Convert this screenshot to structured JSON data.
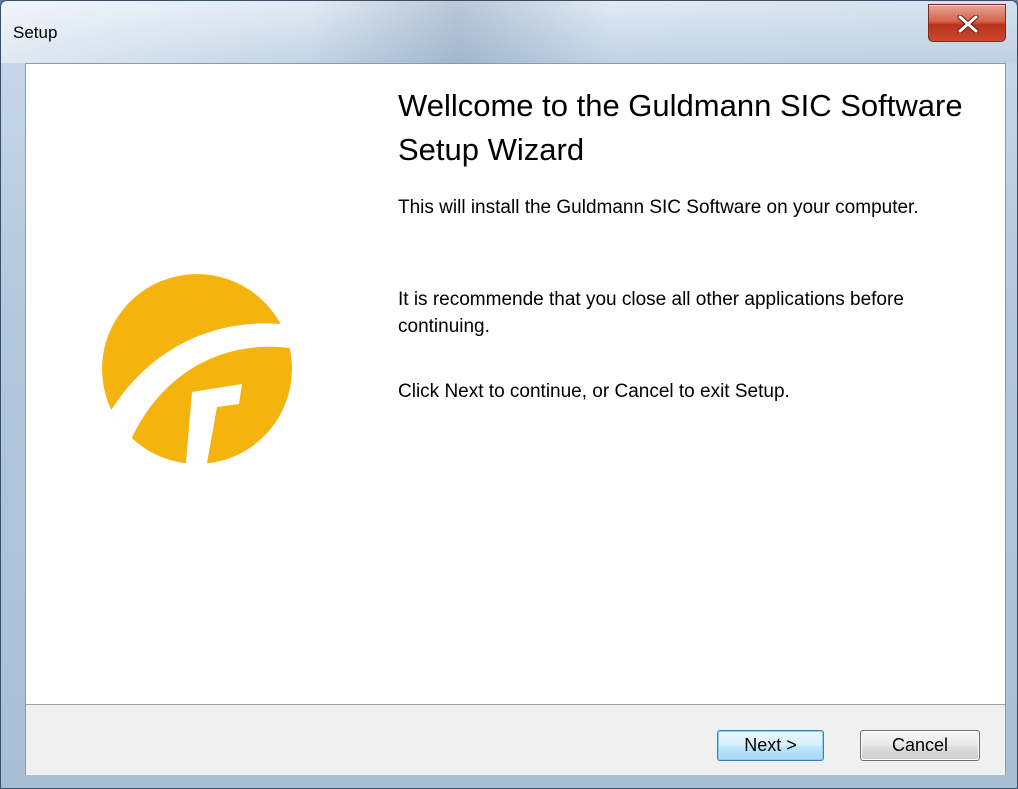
{
  "window": {
    "title": "Setup",
    "close_icon": "close-icon"
  },
  "wizard": {
    "heading": "Wellcome to the Guldmann SIC Software Setup Wizard",
    "paragraph_1": "This will install the Guldmann SIC Software on your computer.",
    "paragraph_2": "It is recommende that you close all other applications before continuing.",
    "paragraph_3": "Click Next to continue, or Cancel to exit Setup.",
    "logo_icon": "guldmann-logo-icon",
    "logo_color": "#f5b30d"
  },
  "buttons": {
    "next_label": "Next >",
    "cancel_label": "Cancel"
  },
  "colors": {
    "close_button": "#c94a30",
    "default_button_border": "#3c7fb1"
  }
}
